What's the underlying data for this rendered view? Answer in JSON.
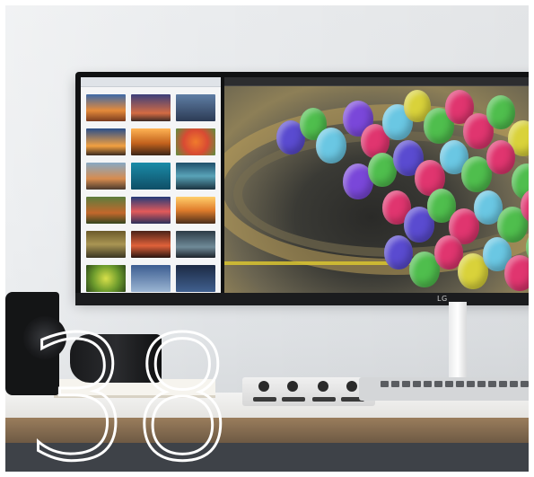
{
  "overlay": {
    "page_number": "38"
  },
  "monitor": {
    "brand_logo": "LG"
  }
}
